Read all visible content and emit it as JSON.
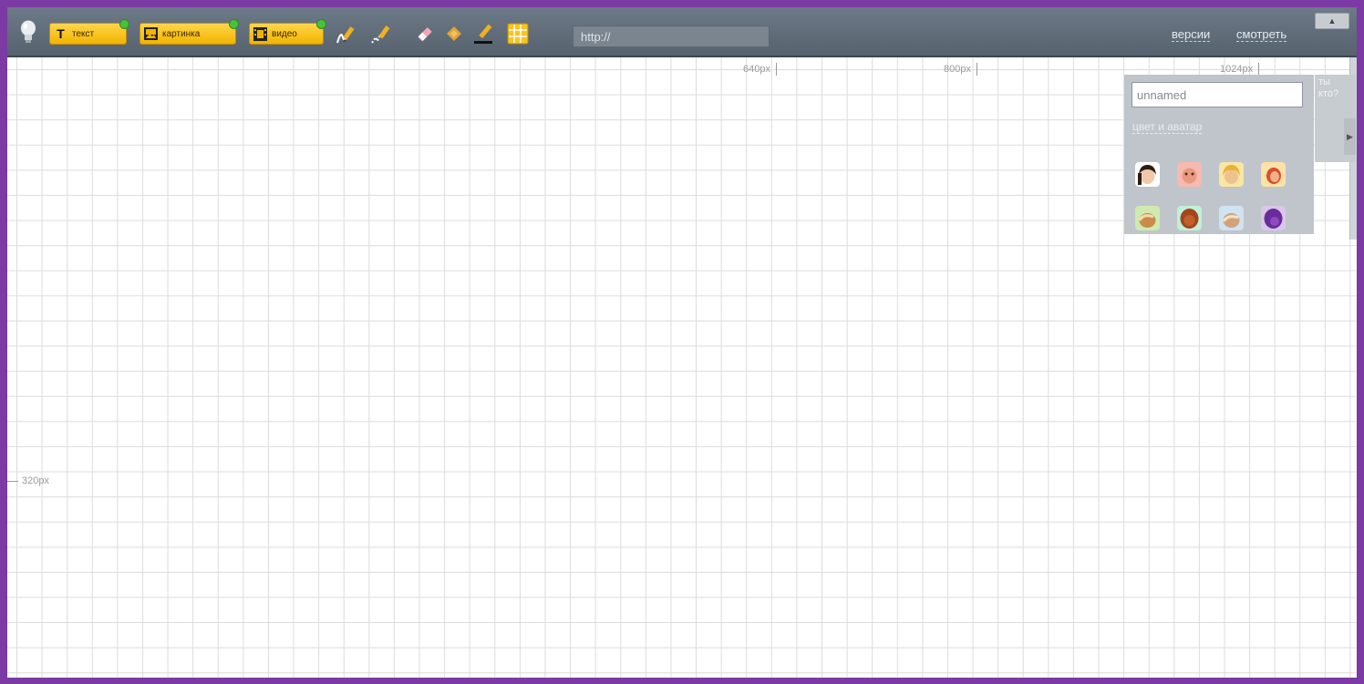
{
  "toolbar": {
    "buttons": {
      "text": "текст",
      "image": "картинка",
      "video": "видео"
    },
    "url": {
      "value": "http://"
    },
    "links": {
      "versions": "версии",
      "view": "смотреть"
    }
  },
  "rulers": {
    "r640": "640px",
    "r800": "800px",
    "r1024": "1024px",
    "r320": "320px"
  },
  "user_panel": {
    "name_value": "unnamed",
    "color_avatar_label": "цвет и аватар",
    "who_label": "ты кто?",
    "avatars": [
      "avatar-dark-hair",
      "avatar-pink",
      "avatar-blonde",
      "avatar-red",
      "avatar-green-bg",
      "avatar-brown",
      "avatar-blue-bg",
      "avatar-purple"
    ]
  },
  "colors": {
    "frame_border": "#7b3aa4",
    "toolbar_bg": "#5e6a76",
    "button_yellow": "#f7c520",
    "panel_bg": "#bfc5cb"
  }
}
